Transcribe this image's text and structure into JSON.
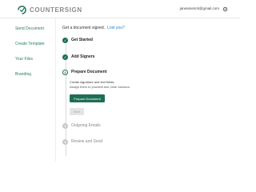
{
  "header": {
    "logo_text": "COUNTERSIGN",
    "user_email": "janeamerick@gmail.com",
    "settings_icon": "gear-icon"
  },
  "sidebar": {
    "items": [
      {
        "label": "Send Document"
      },
      {
        "label": "Create Template"
      },
      {
        "label": "Your Files"
      },
      {
        "label": "Branding"
      }
    ]
  },
  "main": {
    "heading": "Get a document signed.",
    "lost_link": "Lost you?",
    "steps": [
      {
        "number": "1",
        "label": "Get Started",
        "status": "done"
      },
      {
        "number": "2",
        "label": "Add Signers",
        "status": "done"
      },
      {
        "number": "3",
        "label": "Prepare Document",
        "status": "active"
      },
      {
        "number": "4",
        "label": "Outgoing Emails",
        "status": "pending"
      },
      {
        "number": "5",
        "label": "Review and Send",
        "status": "pending"
      }
    ],
    "prepare": {
      "line1": "Create signature and text fields.",
      "line2": "Assign them to yourself and Jane Jackson.",
      "button": "Prepare Document",
      "next": "Next"
    }
  },
  "colors": {
    "accent": "#1e6e56",
    "nav_text": "#2b7a6a",
    "link": "#2a7fc2"
  }
}
